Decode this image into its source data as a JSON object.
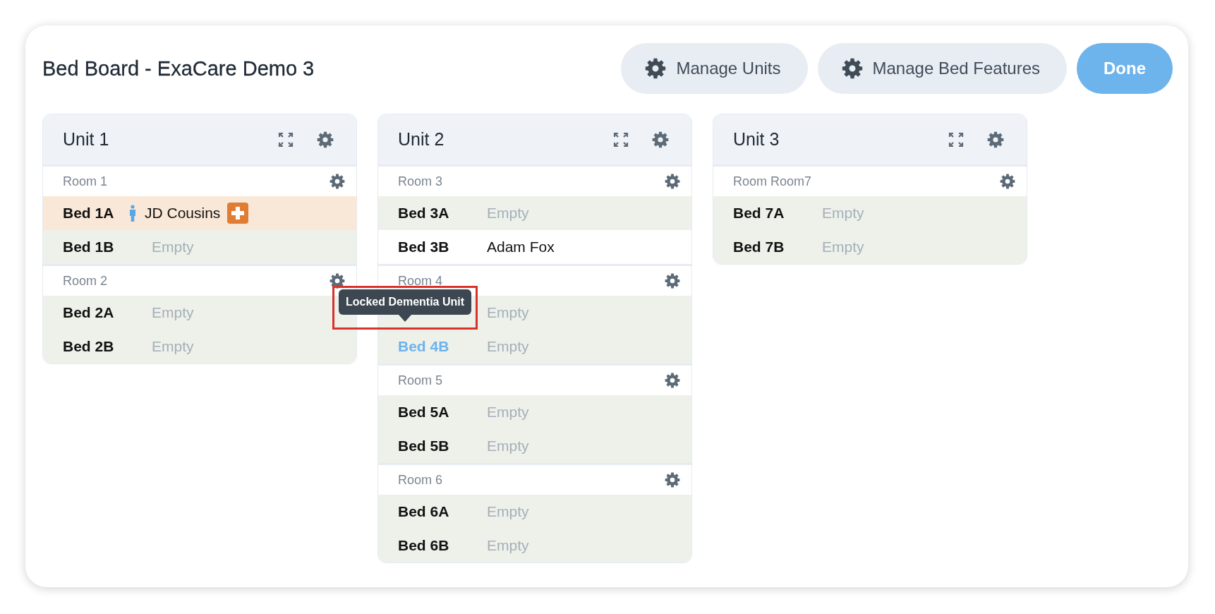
{
  "title": "Bed Board - ExaCare Demo 3",
  "actions": [
    {
      "label": "Manage Units",
      "kind": "secondary"
    },
    {
      "label": "Manage Bed Features",
      "kind": "secondary"
    },
    {
      "label": "Done",
      "kind": "primary"
    }
  ],
  "units": [
    {
      "name": "Unit 1",
      "rooms": [
        {
          "name": "Room 1",
          "beds": [
            {
              "label": "Bed 1A",
              "occupant": "JD Cousins",
              "kind": "alert",
              "highlighted": false
            },
            {
              "label": "Bed 1B",
              "occupant": "Empty",
              "kind": "empty",
              "highlighted": false
            }
          ]
        },
        {
          "name": "Room 2",
          "beds": [
            {
              "label": "Bed 2A",
              "occupant": "Empty",
              "kind": "empty",
              "highlighted": false
            },
            {
              "label": "Bed 2B",
              "occupant": "Empty",
              "kind": "empty",
              "highlighted": false
            }
          ]
        }
      ]
    },
    {
      "name": "Unit 2",
      "rooms": [
        {
          "name": "Room 3",
          "beds": [
            {
              "label": "Bed 3A",
              "occupant": "Empty",
              "kind": "empty",
              "highlighted": false
            },
            {
              "label": "Bed 3B",
              "occupant": "Adam Fox",
              "kind": "occupied",
              "highlighted": false
            }
          ]
        },
        {
          "name": "Room 4",
          "beds": [
            {
              "occupant": "Empty",
              "kind": "empty",
              "tooltip": "Locked Dementia Unit"
            },
            {
              "label": "Bed 4B",
              "occupant": "Empty",
              "kind": "empty",
              "highlighted": true
            }
          ]
        },
        {
          "name": "Room 5",
          "beds": [
            {
              "label": "Bed 5A",
              "occupant": "Empty",
              "kind": "empty",
              "highlighted": false
            },
            {
              "label": "Bed 5B",
              "occupant": "Empty",
              "kind": "empty",
              "highlighted": false
            }
          ]
        },
        {
          "name": "Room 6",
          "beds": [
            {
              "label": "Bed 6A",
              "occupant": "Empty",
              "kind": "empty",
              "highlighted": false
            },
            {
              "label": "Bed 6B",
              "occupant": "Empty",
              "kind": "empty",
              "highlighted": false
            }
          ]
        }
      ]
    },
    {
      "name": "Unit 3",
      "rooms": [
        {
          "name": "Room Room7",
          "beds": [
            {
              "label": "Bed 7A",
              "occupant": "Empty",
              "kind": "empty",
              "highlighted": false
            },
            {
              "label": "Bed 7B",
              "occupant": "Empty",
              "kind": "empty",
              "highlighted": false
            }
          ]
        }
      ]
    }
  ]
}
